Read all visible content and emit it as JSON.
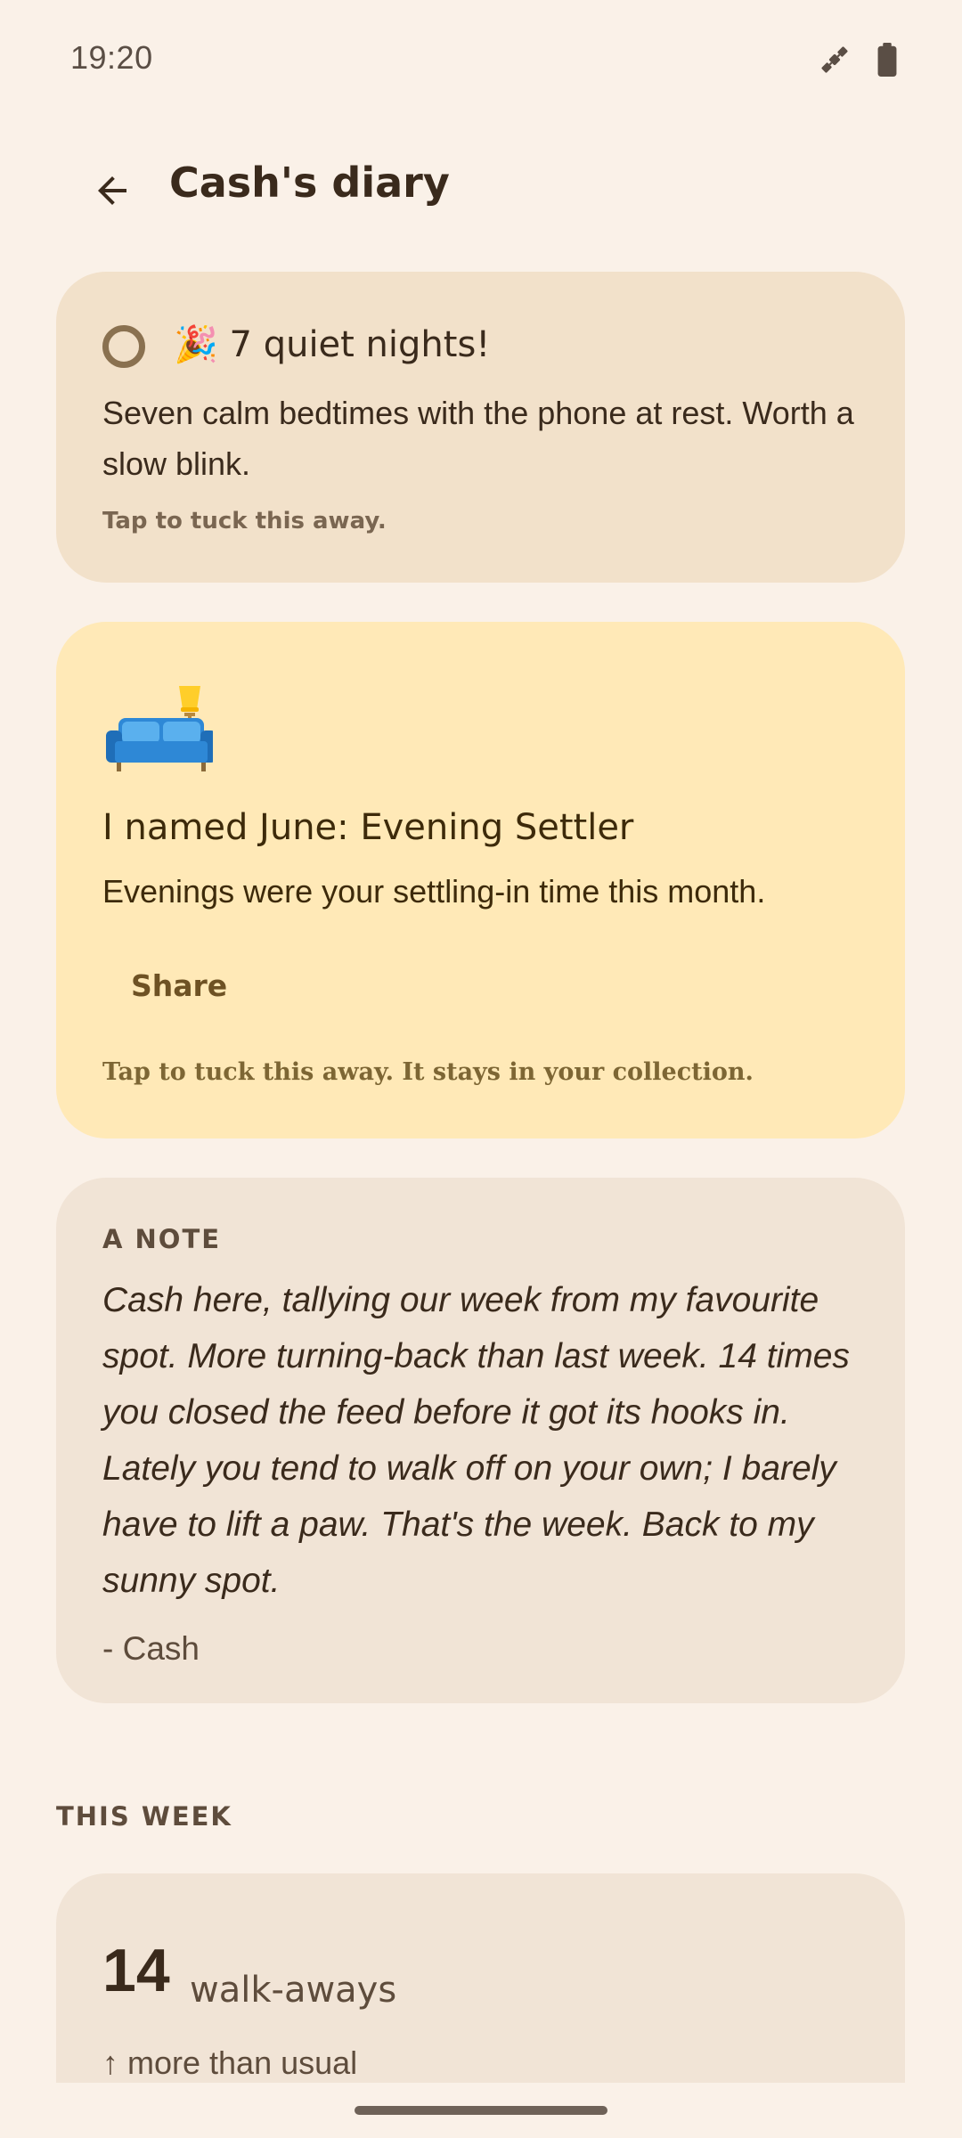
{
  "status_bar": {
    "time": "19:20"
  },
  "header": {
    "title": "Cash's diary"
  },
  "achievement": {
    "emoji": "🎉",
    "title": "7 quiet nights!",
    "body": "Seven calm bedtimes with the phone at rest. Worth a slow blink.",
    "hint": "Tap to tuck this away."
  },
  "monthly": {
    "title": "I named June: Evening Settler",
    "body": "Evenings were your settling-in time this month.",
    "share_label": "Share",
    "hint": "Tap to tuck this away. It stays in your collection."
  },
  "note": {
    "label": "A NOTE",
    "body": "Cash here, tallying our week from my favourite spot. More turning-back than last week. 14 times you closed the feed before it got its hooks in. Lately you tend to walk off on your own; I barely have to lift a paw. That's the week. Back to my sunny spot.",
    "signature": "- Cash"
  },
  "this_week": {
    "section_label": "THIS WEEK",
    "count": "14",
    "unit": "walk-aways",
    "trend": "↑ more than usual"
  }
}
